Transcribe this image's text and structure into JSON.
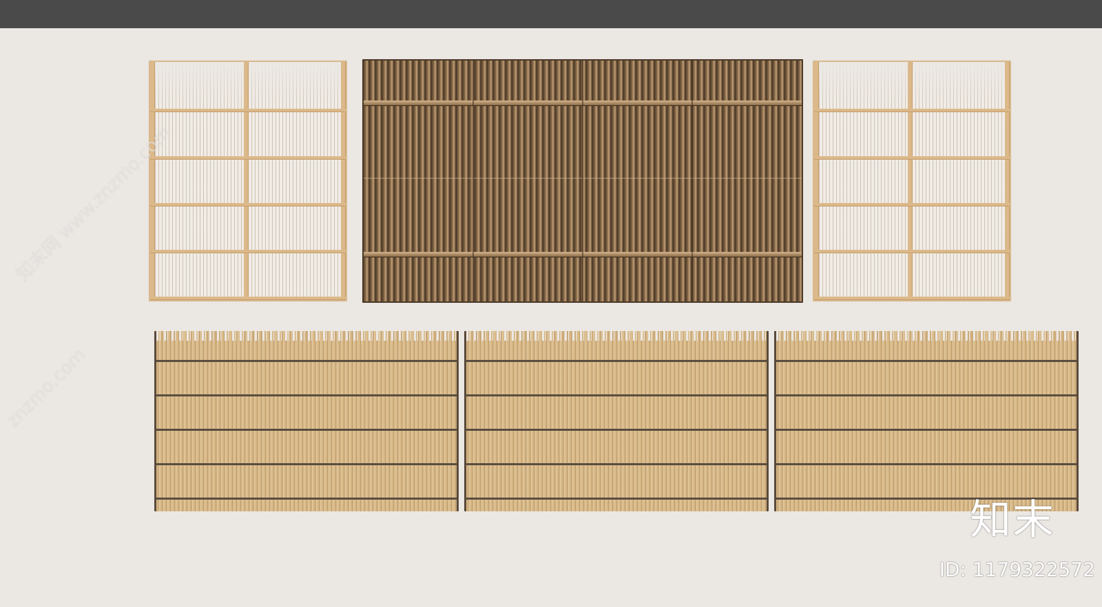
{
  "window": {
    "topbar_color": "#4a4a4a",
    "canvas_color": "#ebe7e3"
  },
  "panels": [
    {
      "name": "light-screen-left",
      "style": "light"
    },
    {
      "name": "dark-bamboo-center",
      "style": "dark"
    },
    {
      "name": "light-screen-right",
      "style": "light"
    },
    {
      "name": "reed-fence-1",
      "style": "reed"
    },
    {
      "name": "reed-fence-2",
      "style": "reed"
    },
    {
      "name": "reed-fence-3",
      "style": "reed"
    }
  ],
  "watermark": {
    "logo_text": "知末",
    "id_text": "ID: 1179322572",
    "diagonal_text_1": "知末网 www.znzmo.com",
    "diagonal_text_2": "znzmo.com"
  },
  "colors": {
    "light_frame": "#dcb98a",
    "dark_bamboo": "#6b533a",
    "reed": "#d6b886",
    "reed_post": "#5a4a3a"
  }
}
